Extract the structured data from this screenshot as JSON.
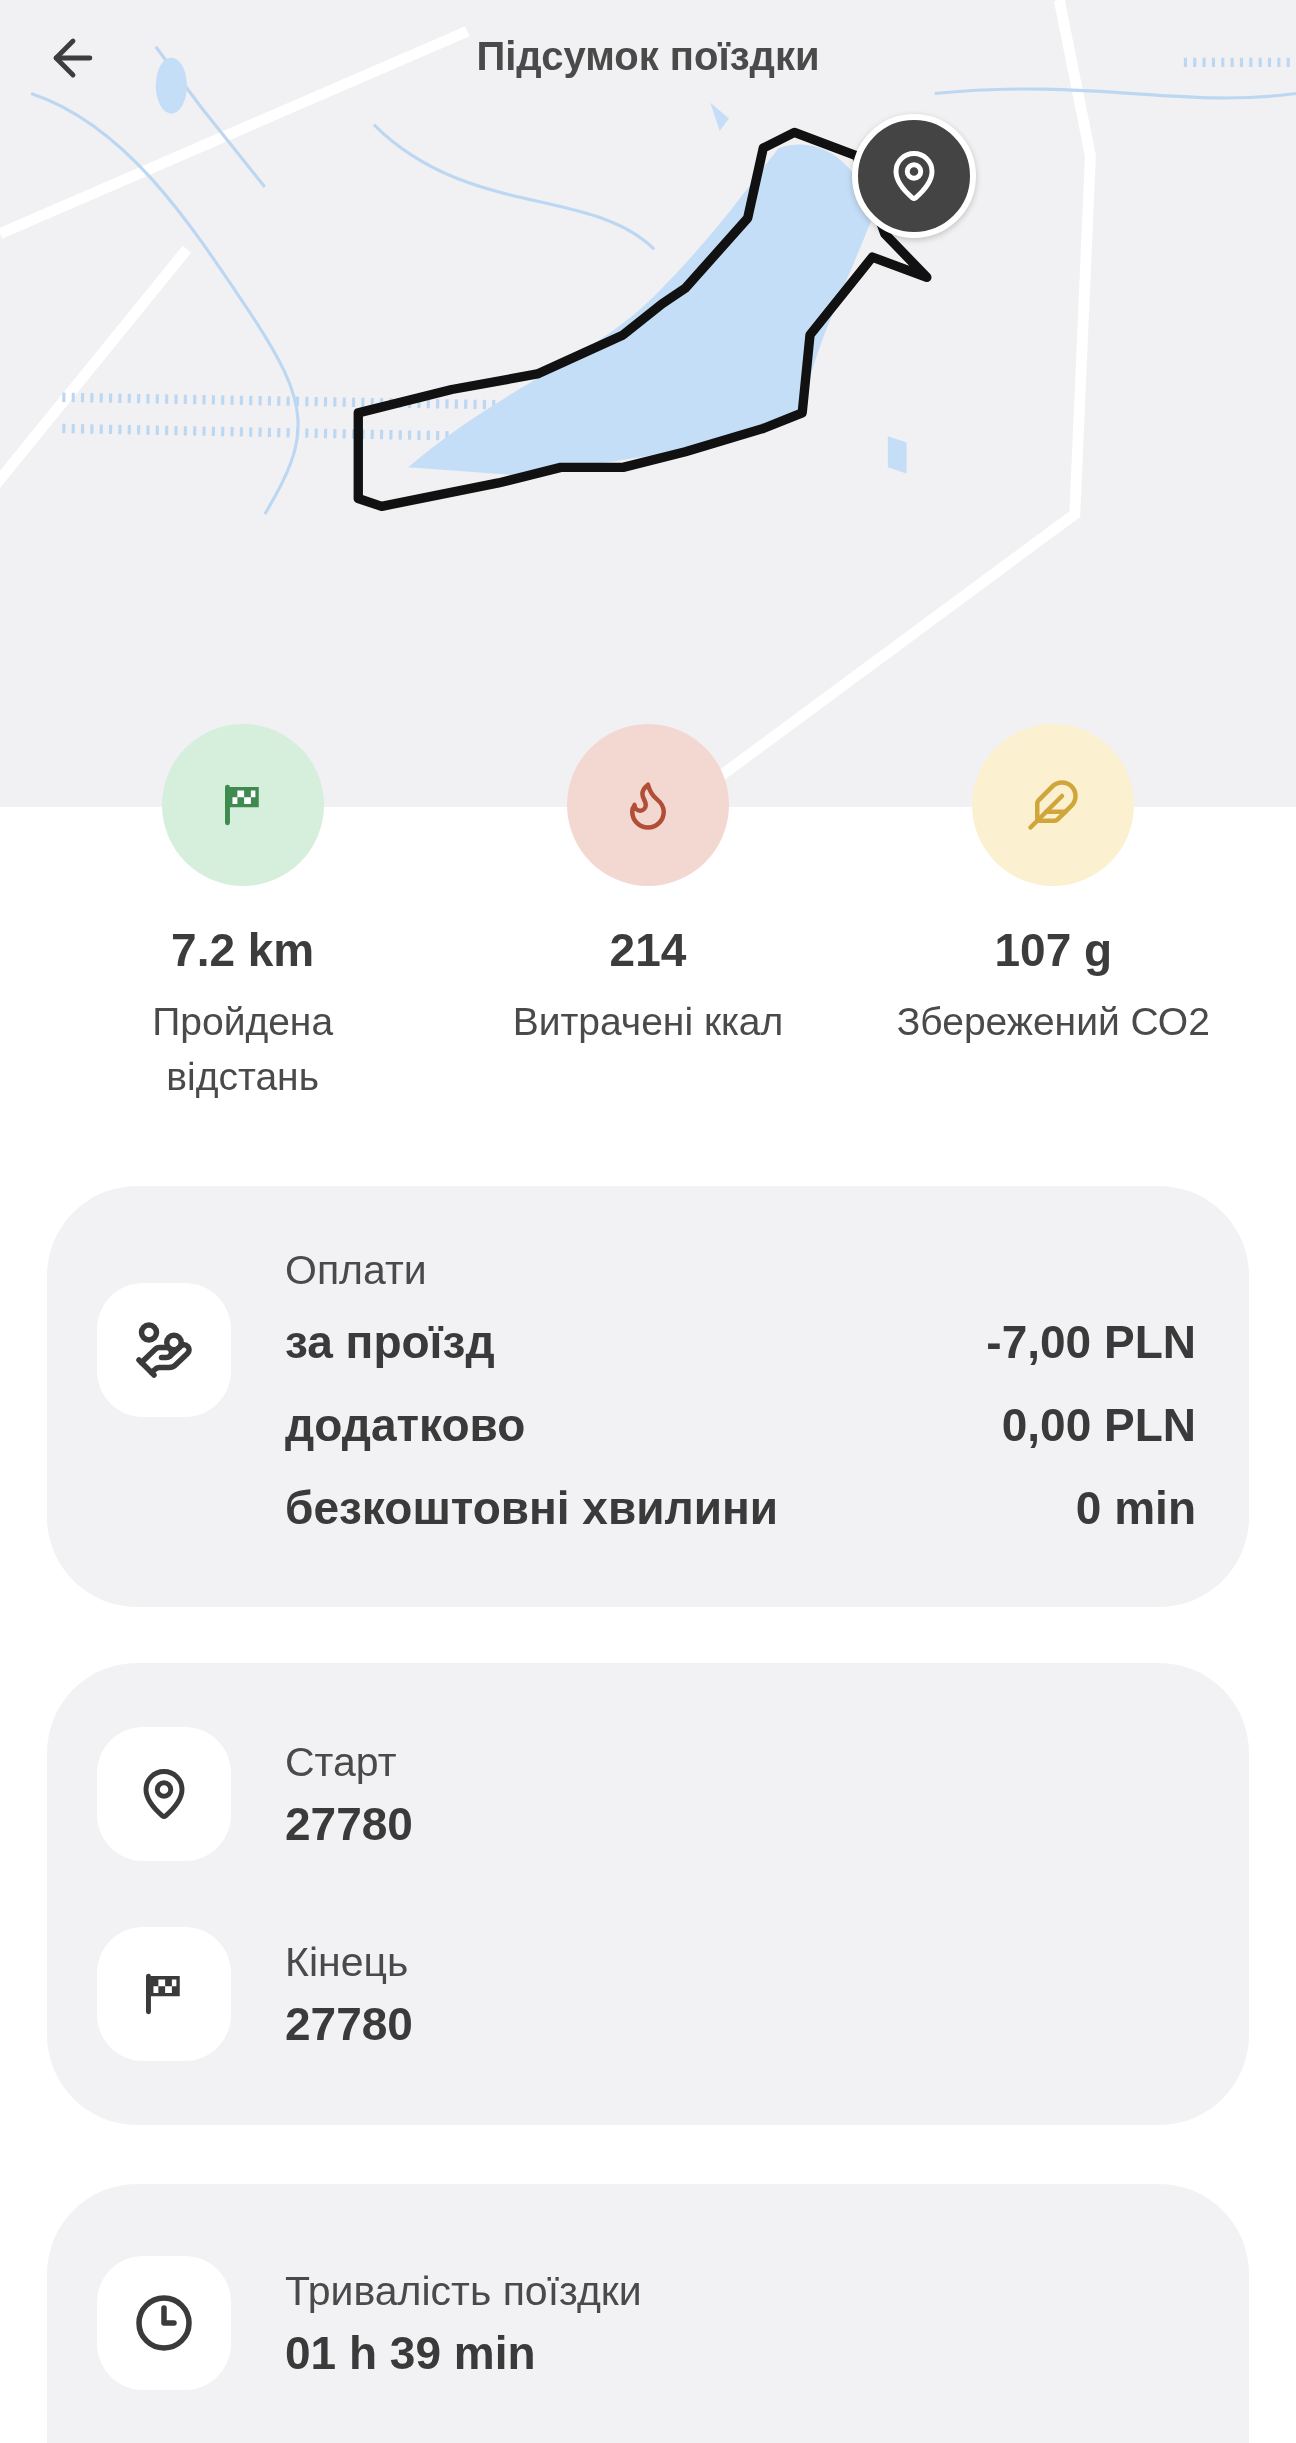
{
  "header": {
    "title": "Підсумок поїздки"
  },
  "stats": [
    {
      "kind": "distance",
      "value": "7.2 km",
      "label": "Пройдена\nвідстань"
    },
    {
      "kind": "calories",
      "value": "214",
      "label": "Витрачені ккал"
    },
    {
      "kind": "co2",
      "value": "107 g",
      "label": "Збережений СО2"
    }
  ],
  "payments": {
    "title": "Оплати",
    "rows": [
      {
        "label": "за проїзд",
        "value": "-7,00 PLN"
      },
      {
        "label": "додатково",
        "value": "0,00 PLN"
      },
      {
        "label": "безкоштовні хвилини",
        "value": "0 min"
      }
    ]
  },
  "points": [
    {
      "kind": "start",
      "label": "Старт",
      "value": "27780"
    },
    {
      "kind": "end",
      "label": "Кінець",
      "value": "27780"
    }
  ],
  "duration": {
    "label": "Тривалість поїздки",
    "value": "01 h 39 min"
  }
}
